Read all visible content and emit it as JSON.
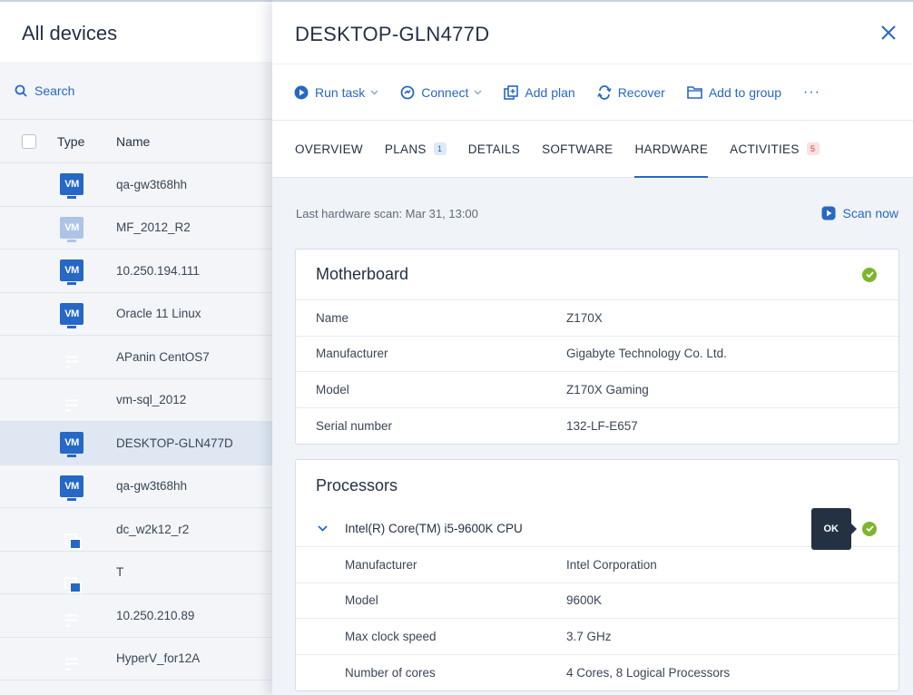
{
  "left": {
    "title": "All devices",
    "search_label": "Search",
    "columns": {
      "type": "Type",
      "name": "Name"
    },
    "devices": [
      {
        "icon": "vm",
        "name": "qa-gw3t68hh"
      },
      {
        "icon": "vm-dim",
        "name": "MF_2012_R2"
      },
      {
        "icon": "vm",
        "name": "10.250.194.111"
      },
      {
        "icon": "vm",
        "name": "Oracle 11 Linux"
      },
      {
        "icon": "server",
        "name": "APanin CentOS7"
      },
      {
        "icon": "server",
        "name": "vm-sql_2012"
      },
      {
        "icon": "vm",
        "name": "DESKTOP-GLN477D",
        "selected": true
      },
      {
        "icon": "vm",
        "name": "qa-gw3t68hh"
      },
      {
        "icon": "cluster",
        "name": "dc_w2k12_r2"
      },
      {
        "icon": "cluster",
        "name": "T"
      },
      {
        "icon": "server",
        "name": "10.250.210.89"
      },
      {
        "icon": "server",
        "name": "HyperV_for12A"
      }
    ],
    "vm_icon_text": "VM"
  },
  "detail": {
    "title": "DESKTOP-GLN477D",
    "toolbar": {
      "run_task": "Run task",
      "connect": "Connect",
      "add_plan": "Add plan",
      "recover": "Recover",
      "add_to_group": "Add to group",
      "more": "···"
    },
    "tabs": {
      "overview": "OVERVIEW",
      "plans": "PLANS",
      "plans_count": "1",
      "details": "DETAILS",
      "software": "SOFTWARE",
      "hardware": "HARDWARE",
      "activities": "ACTIVITIES",
      "activities_count": "5"
    },
    "last_scan": "Last hardware scan: Mar 31, 13:00",
    "scan_now": "Scan now",
    "motherboard": {
      "title": "Motherboard",
      "rows": [
        {
          "k": "Name",
          "v": "Z170X"
        },
        {
          "k": "Manufacturer",
          "v": "Gigabyte Technology Co. Ltd."
        },
        {
          "k": "Model",
          "v": "Z170X Gaming"
        },
        {
          "k": "Serial number",
          "v": "132-LF-E657"
        }
      ]
    },
    "processors": {
      "title": "Processors",
      "cpu_name": "Intel(R) Core(TM) i5-9600K CPU",
      "tooltip": "OK",
      "rows": [
        {
          "k": "Manufacturer",
          "v": "Intel Corporation"
        },
        {
          "k": "Model",
          "v": "9600K"
        },
        {
          "k": "Max clock speed",
          "v": "3.7 GHz"
        },
        {
          "k": "Number of cores",
          "v": "4 Cores, 8 Logical Processors"
        }
      ]
    }
  },
  "colors": {
    "accent": "#2668c5",
    "ok": "#7fb52c",
    "selected_row": "#dfe7f2",
    "tooltip_bg": "#243143"
  }
}
